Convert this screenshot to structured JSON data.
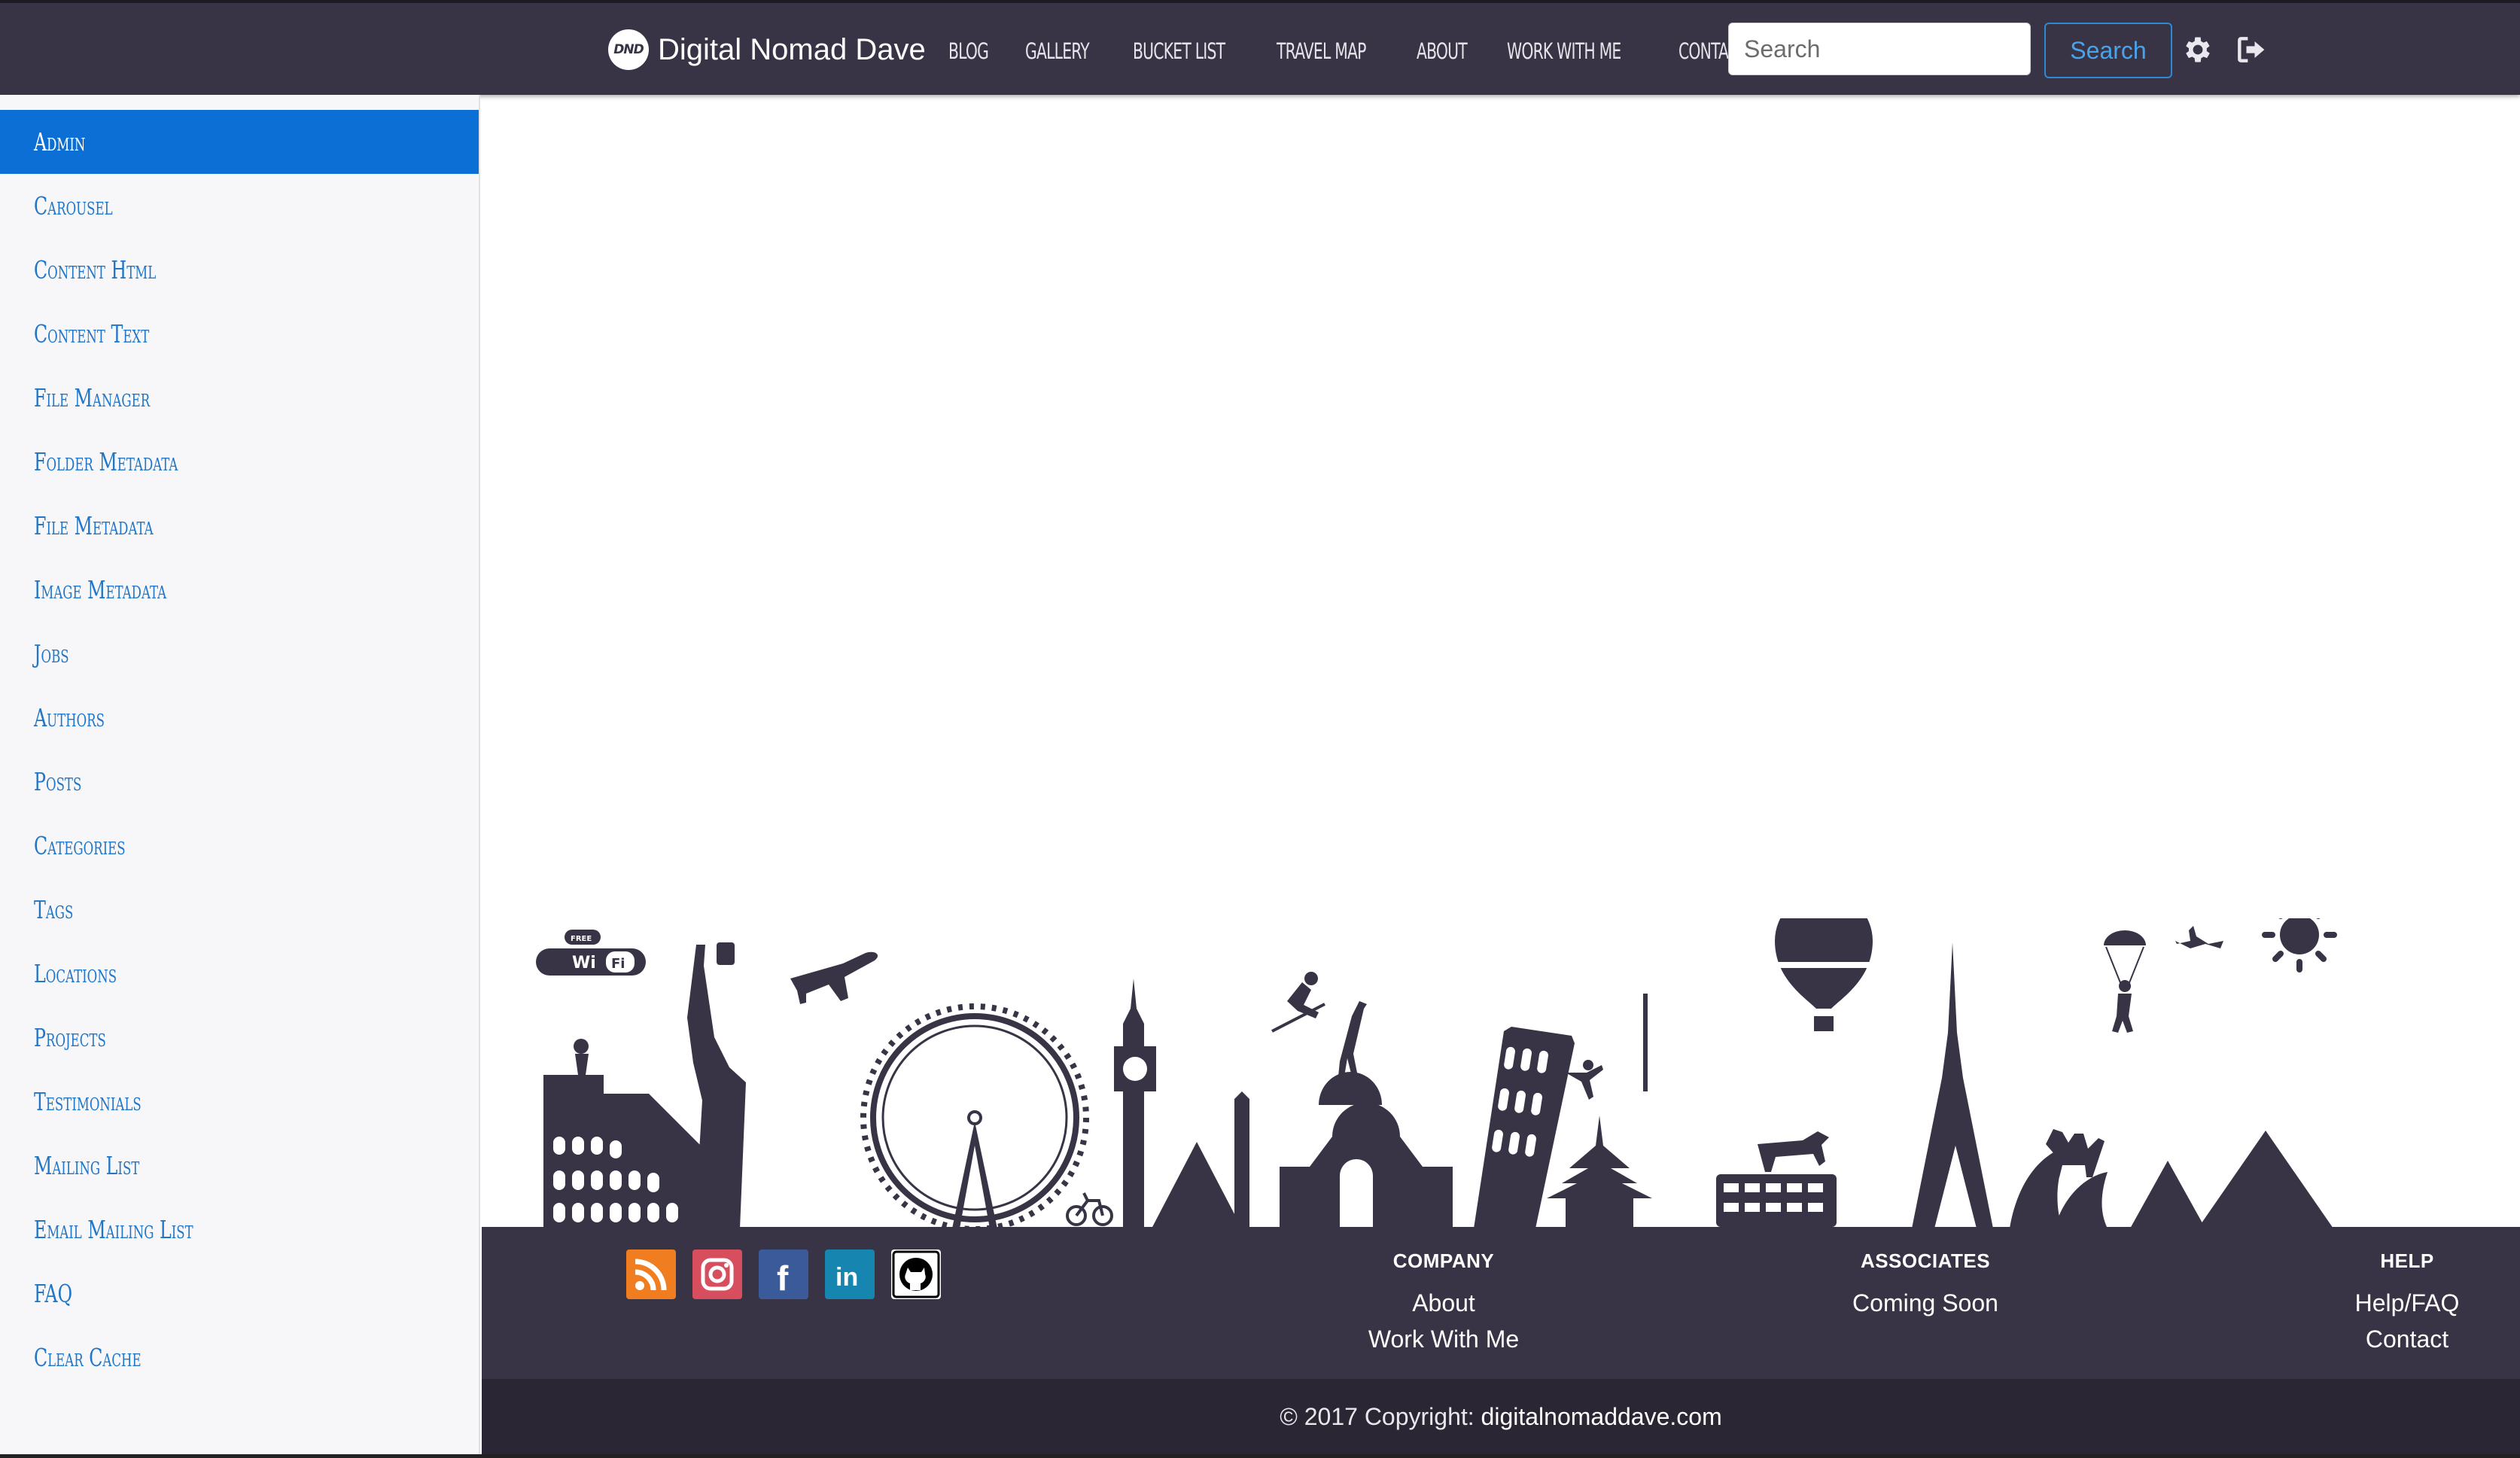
{
  "brand": {
    "logo_text": "DND",
    "name": "Digital Nomad Dave"
  },
  "nav": {
    "links": [
      "BLOG",
      "GALLERY",
      "BUCKET LIST",
      "TRAVEL MAP",
      "ABOUT",
      "WORK WITH ME",
      "CONTACT"
    ]
  },
  "search": {
    "placeholder": "Search",
    "button_label": "Search"
  },
  "icons": {
    "settings": "gear-icon",
    "logout": "sign-out-icon"
  },
  "sidebar": {
    "items": [
      {
        "label": "Admin",
        "active": true
      },
      {
        "label": "Carousel"
      },
      {
        "label": "Content Html"
      },
      {
        "label": "Content Text"
      },
      {
        "label": "File Manager"
      },
      {
        "label": "Folder Metadata"
      },
      {
        "label": "File Metadata"
      },
      {
        "label": "Image Metadata"
      },
      {
        "label": "Jobs"
      },
      {
        "label": "Authors"
      },
      {
        "label": "Posts"
      },
      {
        "label": "Categories"
      },
      {
        "label": "Tags"
      },
      {
        "label": "Locations"
      },
      {
        "label": "Projects"
      },
      {
        "label": "Testimonials"
      },
      {
        "label": "Mailing List"
      },
      {
        "label": "Email Mailing List"
      },
      {
        "label": "FAQ"
      },
      {
        "label": "Clear Cache"
      }
    ]
  },
  "skyline": {
    "wifi_badge_free": "FREE",
    "wifi_badge_wi": "Wi",
    "wifi_badge_fi": "Fi"
  },
  "footer": {
    "social": [
      "rss-icon",
      "instagram-icon",
      "facebook-icon",
      "linkedin-icon",
      "github-icon"
    ],
    "social_text": {
      "facebook": "f",
      "linkedin": "in"
    },
    "company": {
      "title": "COMPANY",
      "links": [
        "About",
        "Work With Me"
      ]
    },
    "associates": {
      "title": "ASSOCIATES",
      "links": [
        "Coming Soon"
      ]
    },
    "help": {
      "title": "HELP",
      "links": [
        "Help/FAQ",
        "Contact"
      ]
    },
    "copyright_prefix": "© 2017 Copyright: ",
    "copyright_link": "digitalnomaddave.com"
  },
  "colors": {
    "nav_bg": "#393445",
    "accent": "#0c6fd6",
    "link": "#2176c7",
    "footer_bg": "#393445",
    "copyright_bg": "#2a2633"
  }
}
